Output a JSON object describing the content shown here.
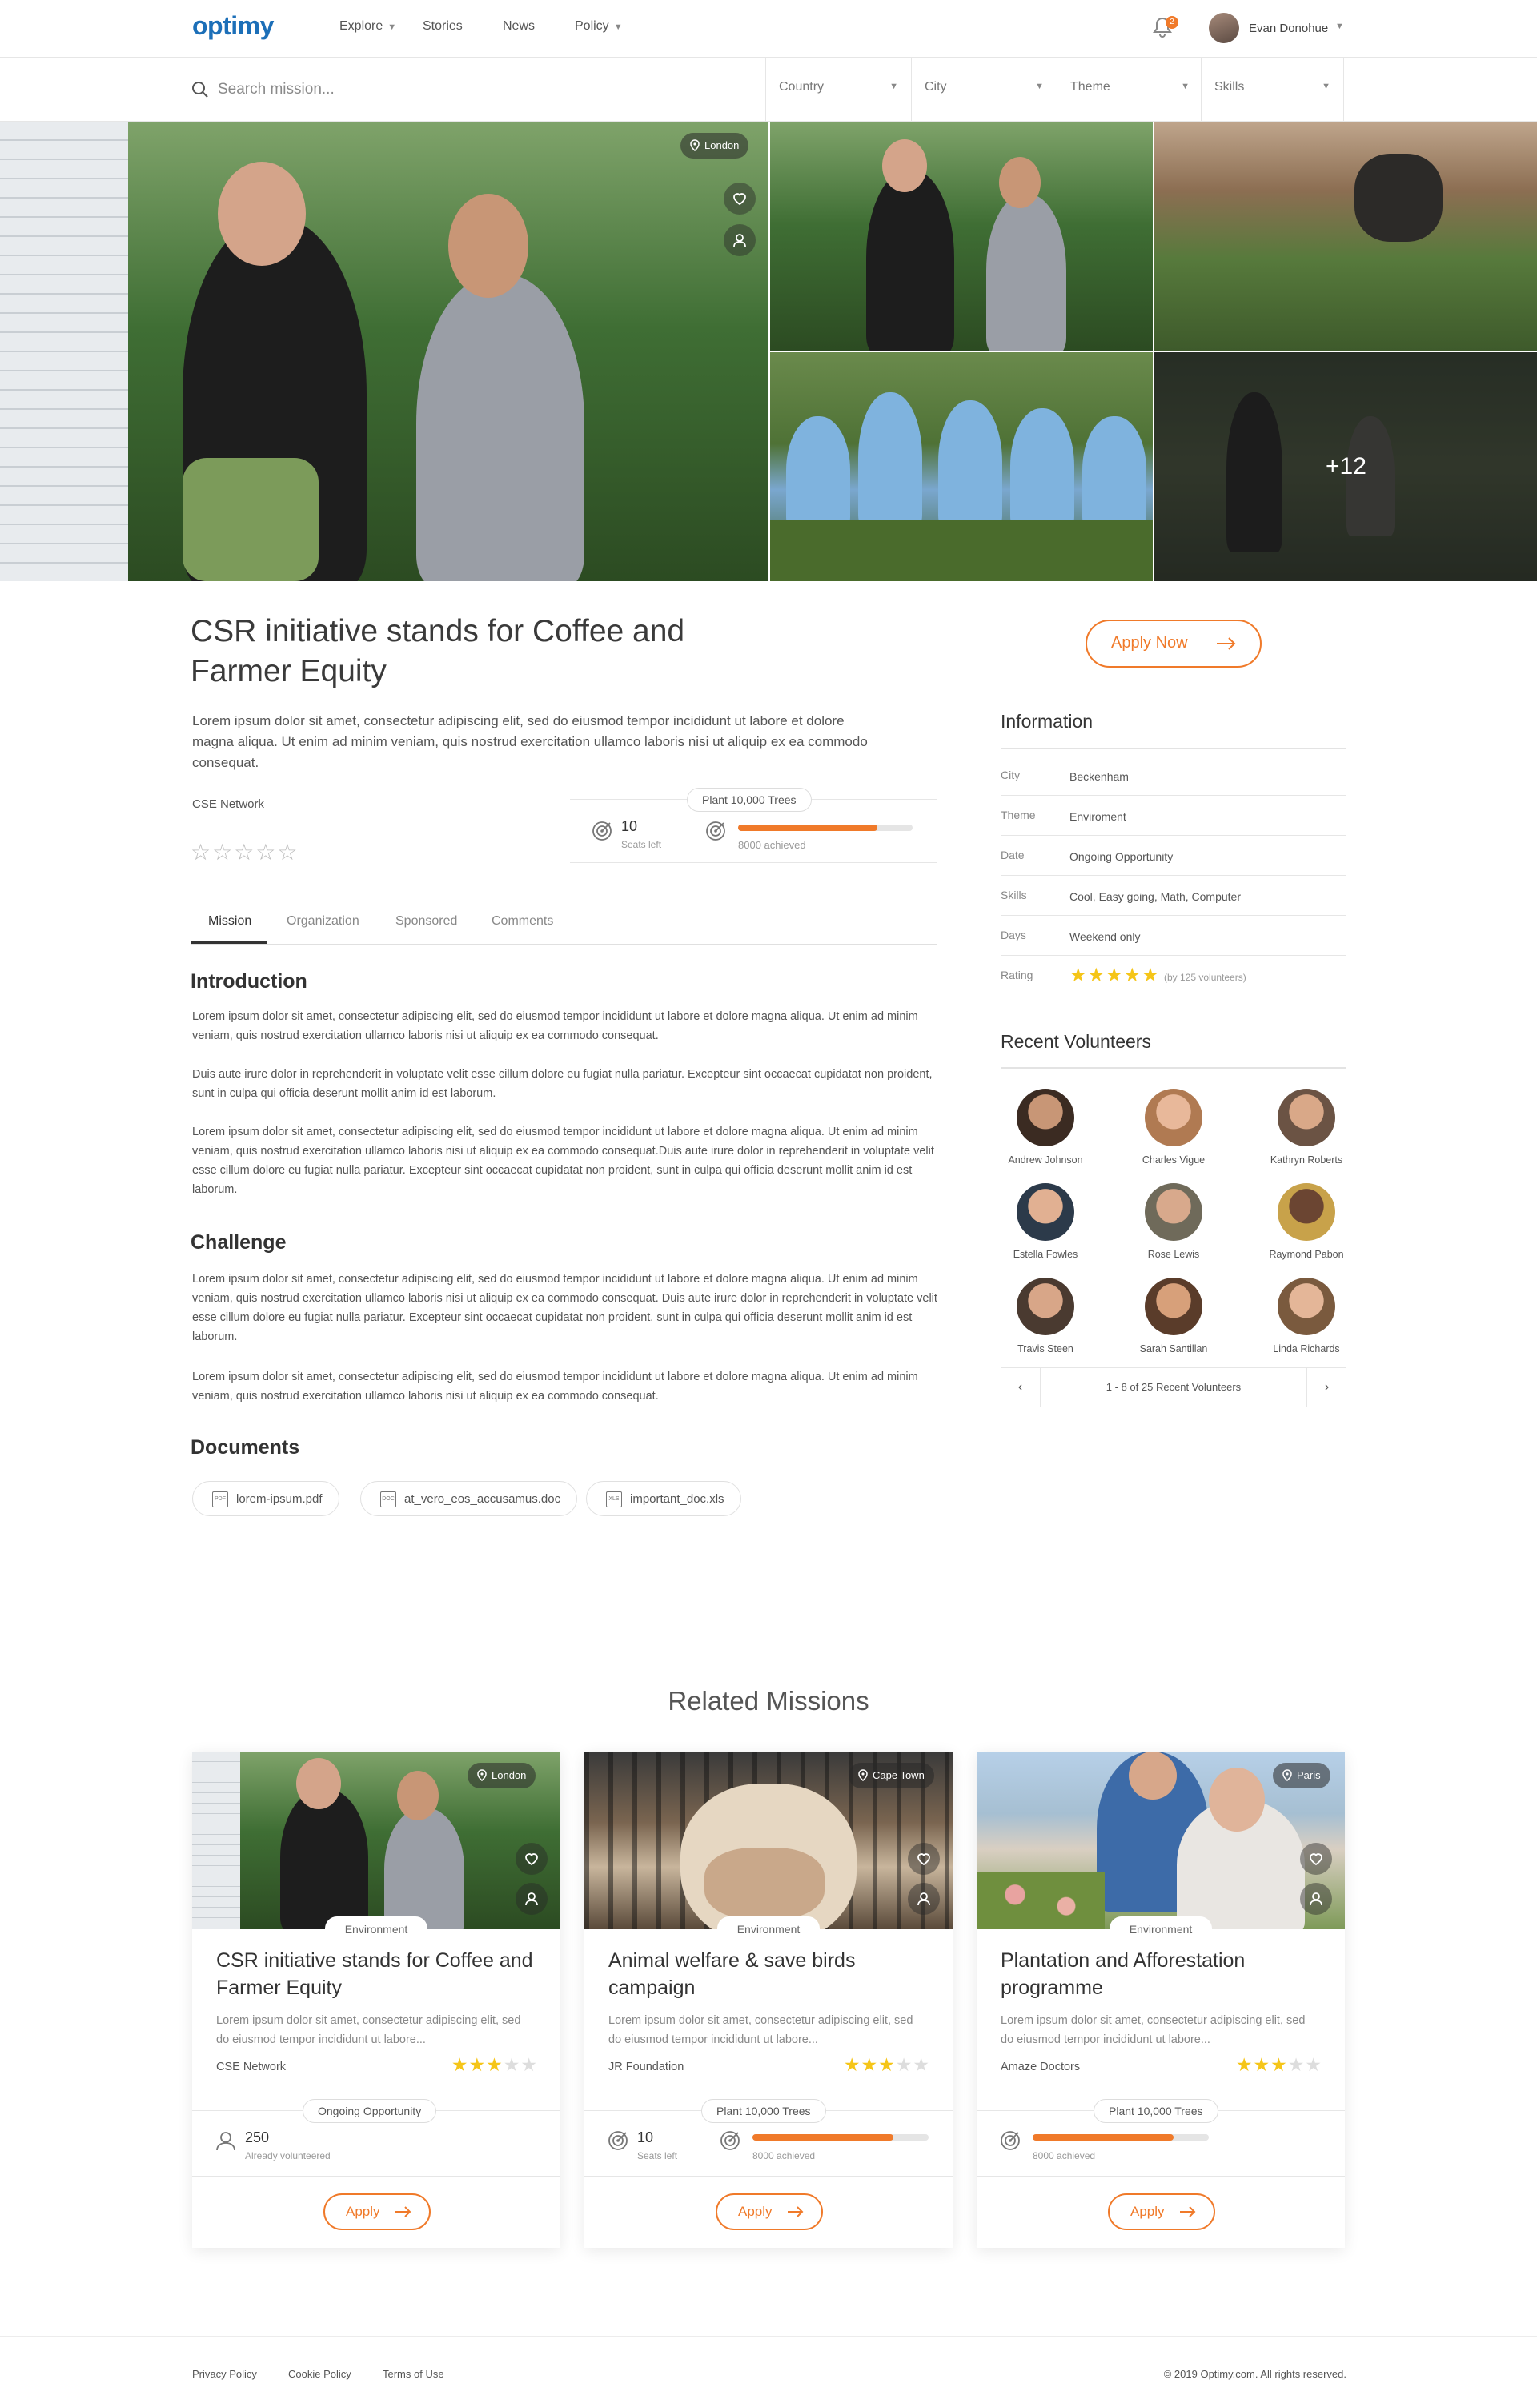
{
  "header": {
    "logo": "optimy",
    "nav": [
      {
        "label": "Explore",
        "has_menu": true
      },
      {
        "label": "Stories",
        "has_menu": false
      },
      {
        "label": "News",
        "has_menu": false
      },
      {
        "label": "Policy",
        "has_menu": true
      }
    ],
    "notification_count": "2",
    "user_name": "Evan Donohue",
    "accent_color": "#f07a2a",
    "brand_color": "#1c6fb8"
  },
  "search": {
    "placeholder": "Search mission...",
    "filters": [
      "Country",
      "City",
      "Theme",
      "Skills"
    ]
  },
  "gallery": {
    "location": "London",
    "more_count": "+12",
    "icons": [
      "heart-icon",
      "user-share-icon",
      "map-pin-icon"
    ]
  },
  "mission": {
    "title": "CSR initiative stands for Coffee and Farmer Equity",
    "description": "Lorem ipsum dolor sit amet, consectetur adipiscing elit, sed do eiusmod tempor incididunt ut labore et dolore magna aliqua. Ut enim ad minim veniam, quis nostrud exercitation ullamco laboris nisi ut aliquip ex ea commodo consequat.",
    "organization": "CSE Network",
    "user_rating": 0,
    "rating_max": 5,
    "seats": "10",
    "seats_label": "Seats left",
    "goal": "Plant 10,000 Trees",
    "goal_progress": 0.8,
    "goal_achieved": "8000 achieved",
    "apply_label": "Apply Now"
  },
  "tabs": [
    {
      "label": "Mission",
      "active": true
    },
    {
      "label": "Organization",
      "active": false
    },
    {
      "label": "Sponsored",
      "active": false
    },
    {
      "label": "Comments",
      "active": false
    }
  ],
  "content": {
    "introduction_title": "Introduction",
    "intro_p1": "Lorem ipsum dolor sit amet, consectetur adipiscing elit, sed do eiusmod tempor incididunt ut labore et dolore magna aliqua. Ut enim ad minim veniam, quis nostrud exercitation ullamco laboris nisi ut aliquip ex ea commodo consequat.",
    "intro_p2": "Duis aute irure dolor in reprehenderit in voluptate velit esse cillum dolore eu fugiat nulla pariatur. Excepteur sint occaecat cupidatat non proident, sunt in culpa qui officia deserunt mollit anim id est laborum.",
    "intro_p3": "Lorem ipsum dolor sit amet, consectetur adipiscing elit, sed do eiusmod tempor incididunt ut labore et dolore magna aliqua. Ut enim ad minim veniam, quis nostrud exercitation ullamco laboris nisi ut aliquip ex ea commodo consequat.Duis aute irure dolor in reprehenderit in voluptate velit esse cillum dolore eu fugiat nulla pariatur. Excepteur sint occaecat cupidatat non proident, sunt in culpa qui officia deserunt mollit anim id est laborum.",
    "challenge_title": "Challenge",
    "challenge_p1": "Lorem ipsum dolor sit amet, consectetur adipiscing elit, sed do eiusmod tempor incididunt ut labore et dolore magna aliqua. Ut enim ad minim veniam, quis nostrud exercitation ullamco laboris nisi ut aliquip ex ea commodo consequat. Duis aute irure dolor in reprehenderit in voluptate velit esse cillum dolore eu fugiat nulla pariatur. Excepteur sint occaecat cupidatat non proident, sunt in culpa qui officia deserunt mollit anim id est laborum.",
    "challenge_p2": "Lorem ipsum dolor sit amet, consectetur adipiscing elit, sed do eiusmod tempor incididunt ut labore et dolore magna aliqua. Ut enim ad minim veniam, quis nostrud exercitation ullamco laboris nisi ut aliquip ex ea commodo consequat.",
    "documents_title": "Documents",
    "documents": [
      {
        "name": "lorem-ipsum.pdf",
        "type": "PDF"
      },
      {
        "name": "at_vero_eos_accusamus.doc",
        "type": "DOC"
      },
      {
        "name": "important_doc.xls",
        "type": "XLS"
      }
    ]
  },
  "information": {
    "title": "Information",
    "rows": [
      {
        "key": "City",
        "value": "Beckenham"
      },
      {
        "key": "Theme",
        "value": "Enviroment"
      },
      {
        "key": "Date",
        "value": "Ongoing Opportunity"
      },
      {
        "key": "Skills",
        "value": "Cool, Easy going, Math, Computer"
      },
      {
        "key": "Days",
        "value": "Weekend only"
      }
    ],
    "rating_label": "Rating",
    "rating_value": 5,
    "rating_count": "(by 125 volunteers)"
  },
  "volunteers": {
    "title": "Recent Volunteers",
    "people": [
      "Andrew Johnson",
      "Charles Vigue",
      "Kathryn Roberts",
      "Estella Fowles",
      "Rose Lewis",
      "Raymond Pabon",
      "Travis Steen",
      "Sarah Santillan",
      "Linda Richards"
    ],
    "pager_text": "1 - 8 of 25 Recent Volunteers"
  },
  "related": {
    "title": "Related Missions",
    "cards": [
      {
        "location": "London",
        "category": "Environment",
        "title": "CSR initiative stands for Coffee and Farmer Equity",
        "desc": "Lorem ipsum dolor sit amet, consectetur adipiscing elit, sed do eiusmod tempor incididunt ut labore...",
        "org": "CSE Network",
        "rating": 3,
        "pill": "Ongoing Opportunity",
        "num": "250",
        "num_label": "Already volunteered",
        "apply": "Apply"
      },
      {
        "location": "Cape Town",
        "category": "Environment",
        "title": "Animal welfare & save birds campaign",
        "desc": "Lorem ipsum dolor sit amet, consectetur adipiscing elit, sed do eiusmod tempor incididunt ut labore...",
        "org": "JR Foundation",
        "rating": 3,
        "pill": "Plant 10,000 Trees",
        "num": "10",
        "num_label": "Seats left",
        "progress": 0.8,
        "progress_label": "8000 achieved",
        "apply": "Apply"
      },
      {
        "location": "Paris",
        "category": "Environment",
        "title": "Plantation and Afforestation programme",
        "desc": "Lorem ipsum dolor sit amet, consectetur adipiscing elit, sed do eiusmod tempor incididunt ut labore...",
        "org": "Amaze Doctors",
        "rating": 3,
        "pill": "Plant 10,000 Trees",
        "progress": 0.8,
        "progress_label": "8000 achieved",
        "apply": "Apply"
      }
    ]
  },
  "footer": {
    "links": [
      "Privacy Policy",
      "Cookie Policy",
      "Terms of Use"
    ],
    "copyright": "© 2019 Optimy.com. All rights reserved."
  }
}
